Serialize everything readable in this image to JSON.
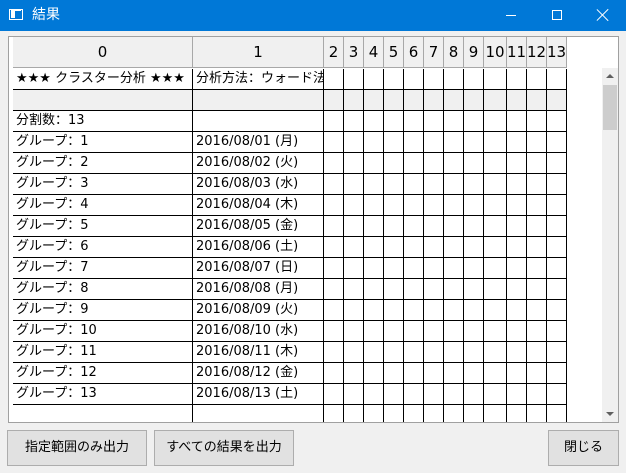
{
  "window": {
    "title": "結果"
  },
  "grid": {
    "columns": [
      "0",
      "1",
      "2",
      "3",
      "4",
      "5",
      "6",
      "7",
      "8",
      "9",
      "10",
      "11",
      "12",
      "13"
    ],
    "rows": [
      [
        "★★★ クラスター分析 ★★★",
        "分析方法：ウォード法"
      ],
      [
        "",
        ""
      ],
      [
        "分割数：13",
        ""
      ],
      [
        "グループ：1",
        "2016/08/01 (月)"
      ],
      [
        "グループ：2",
        "2016/08/02 (火)"
      ],
      [
        "グループ：3",
        "2016/08/03 (水)"
      ],
      [
        "グループ：4",
        "2016/08/04 (木)"
      ],
      [
        "グループ：5",
        "2016/08/05 (金)"
      ],
      [
        "グループ：6",
        "2016/08/06 (土)"
      ],
      [
        "グループ：7",
        "2016/08/07 (日)"
      ],
      [
        "グループ：8",
        "2016/08/08 (月)"
      ],
      [
        "グループ：9",
        "2016/08/09 (火)"
      ],
      [
        "グループ：10",
        "2016/08/10 (水)"
      ],
      [
        "グループ：11",
        "2016/08/11 (木)"
      ],
      [
        "グループ：12",
        "2016/08/12 (金)"
      ],
      [
        "グループ：13",
        "2016/08/13 (土)"
      ],
      [
        "",
        ""
      ]
    ]
  },
  "buttons": {
    "export_range": "指定範囲のみ出力",
    "export_all": "すべての結果を出力",
    "close": "閉じる"
  },
  "colors": {
    "titlebar": "#0078d7",
    "header_bg": "#f0f0f0"
  }
}
